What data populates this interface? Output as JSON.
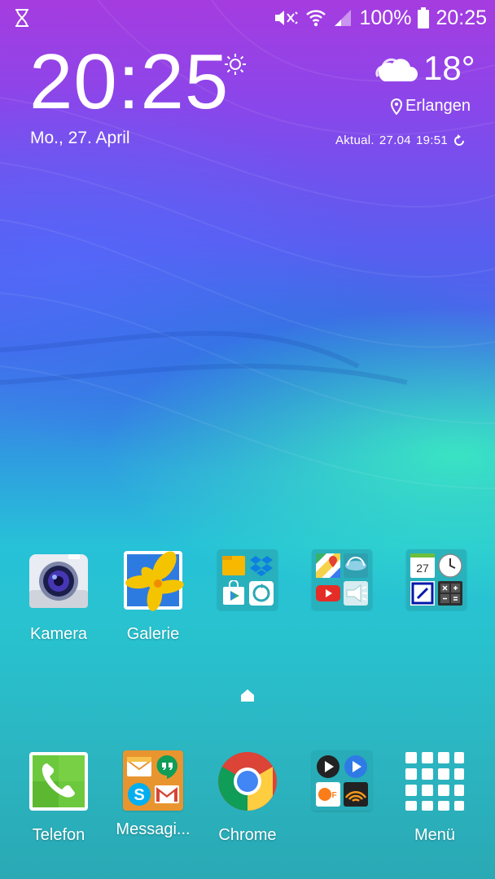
{
  "status_bar": {
    "battery": "100%",
    "time": "20:25"
  },
  "clock_widget": {
    "time": "20:25",
    "date": "Mo., 27. April"
  },
  "weather_widget": {
    "temperature": "18°",
    "location": "Erlangen",
    "updated_label": "Aktual.",
    "updated_date": "27.04",
    "updated_time": "19:51"
  },
  "home_row": [
    {
      "label": "Kamera"
    },
    {
      "label": "Galerie"
    }
  ],
  "dock": [
    {
      "label": "Telefon"
    },
    {
      "label": "Messagi..."
    },
    {
      "label": "Chrome"
    },
    {
      "label": ""
    },
    {
      "label": "Menü"
    }
  ],
  "calendar_day": "27",
  "colors": {
    "phone_green": "#6cc83c",
    "gallery_yellow": "#f5c400",
    "folder_bg": "#2aa8b4"
  }
}
